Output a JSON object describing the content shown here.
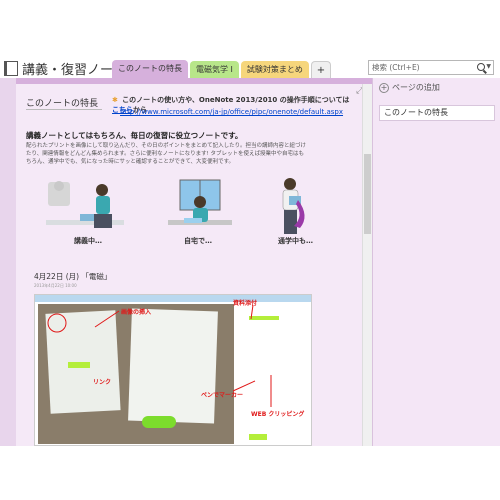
{
  "notebook": {
    "title": "講義・復習ノート"
  },
  "tabs": [
    {
      "label": "このノートの特長"
    },
    {
      "label": "電磁気学 I"
    },
    {
      "label": "試験対策まとめ"
    },
    {
      "label": "+"
    }
  ],
  "search": {
    "placeholder": "検索 (Ctrl+E)"
  },
  "panel": {
    "add_page": "ページの追加",
    "pages": [
      "このノートの特長"
    ]
  },
  "page": {
    "title": "このノートの特長",
    "intro_prefix": "このノートの使い方や、OneNote 2013/2010 の操作手順については",
    "intro_link": "こちら",
    "intro_suffix": "から",
    "url": "http://www.microsoft.com/ja-jp/office/pipc/onenote/default.aspx",
    "headline": "講義ノートとしてはもちろん、毎日の復習に役立つノートです。",
    "body": "配られたプリントを画像にして取り込んだり、その日のポイントをまとめて記入したり。担当の講師内容と紐づけたり、関連情報をどんどん集められます。さらに便利なノートになります! タブレットを使えば授業中や自宅はもちろん、通学中でも、気になった時にサッと確認することができて、大変便利です。",
    "figures": [
      {
        "label": "講義中…"
      },
      {
        "label": "自宅で…"
      },
      {
        "label": "通学中も…"
      }
    ],
    "date_title": "4月22日 (月) 「電磁」",
    "date_sub": "2013年4月22日     10:00",
    "annotations": {
      "image": "画像の挿入",
      "file": "資料添付",
      "link": "リンク",
      "marker": "ペンでマーカー",
      "clip": "WEB クリッピング"
    }
  },
  "colors": {
    "tab_active": "#d6b0dc",
    "tab_green": "#b8e68a",
    "tab_yellow": "#f6d67c",
    "canvas": "#f5e9f7",
    "link": "#0044cc",
    "annotation": "#e01818"
  }
}
